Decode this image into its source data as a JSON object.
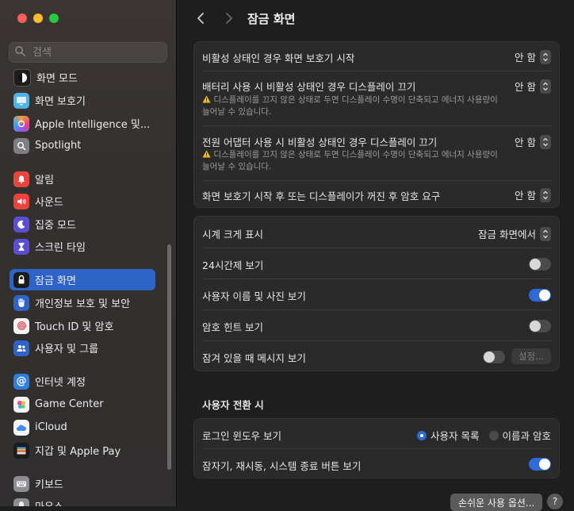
{
  "window": {
    "title": "잠금 화면"
  },
  "search": {
    "placeholder": "검색"
  },
  "sidebar": {
    "items": [
      {
        "label": "화면 모드",
        "icon": "appearance-icon"
      },
      {
        "label": "화면 보호기",
        "icon": "screen-saver-icon"
      },
      {
        "label": "Apple Intelligence 및...",
        "icon": "apple-intelligence-icon"
      },
      {
        "label": "Spotlight",
        "icon": "spotlight-icon"
      },
      {
        "label": "알림",
        "icon": "notifications-icon"
      },
      {
        "label": "사운드",
        "icon": "sound-icon"
      },
      {
        "label": "집중 모드",
        "icon": "focus-icon"
      },
      {
        "label": "스크린 타임",
        "icon": "screen-time-icon"
      },
      {
        "label": "잠금 화면",
        "icon": "lock-screen-icon",
        "selected": true
      },
      {
        "label": "개인정보 보호 및 보안",
        "icon": "privacy-hand-icon"
      },
      {
        "label": "Touch ID 및 암호",
        "icon": "fingerprint-icon"
      },
      {
        "label": "사용자 및 그룹",
        "icon": "users-icon"
      },
      {
        "label": "인터넷 계정",
        "icon": "internet-accounts-icon"
      },
      {
        "label": "Game Center",
        "icon": "game-center-icon"
      },
      {
        "label": "iCloud",
        "icon": "icloud-icon"
      },
      {
        "label": "지갑 및 Apple Pay",
        "icon": "wallet-icon"
      },
      {
        "label": "키보드",
        "icon": "keyboard-icon"
      },
      {
        "label": "마우스",
        "icon": "mouse-icon"
      }
    ]
  },
  "group1": {
    "rows": [
      {
        "label": "비활성 상태인 경우 화면 보호기 시작",
        "value": "안 함"
      },
      {
        "label": "배터리 사용 시 비활성 상태인 경우 디스플레이 끄기",
        "value": "안 함",
        "warning": "디스플레이를 끄지 않은 상태로 두면 디스플레이 수명이 단축되고 에너지 사용량이 늘어날 수 있습니다."
      },
      {
        "label": "전원 어댑터 사용 시 비활성 상태인 경우 디스플레이 끄기",
        "value": "안 함",
        "warning": "디스플레이를 끄지 않은 상태로 두면 디스플레이 수명이 단축되고 에너지 사용량이 늘어날 수 있습니다."
      },
      {
        "label": "화면 보호기 시작 후 또는 디스플레이가 꺼진 후 암호 요구",
        "value": "안 함"
      }
    ]
  },
  "group2": {
    "clock_size": {
      "label": "시계 크게 표시",
      "value": "잠금 화면에서"
    },
    "show_24h": {
      "label": "24시간제 보기",
      "on": false
    },
    "show_user_photo": {
      "label": "사용자 이름 및 사진 보기",
      "on": true
    },
    "show_hint": {
      "label": "암호 힌트 보기",
      "on": false
    },
    "show_message": {
      "label": "잠겨 있을 때 메시지 보기",
      "on": false,
      "button": "설정..."
    }
  },
  "user_switch": {
    "section_title": "사용자 전환 시",
    "login_window": {
      "label": "로그인 윈도우 보기",
      "options": [
        "사용자 목록",
        "이름과 암호"
      ],
      "selected": "사용자 목록"
    },
    "show_buttons": {
      "label": "잠자기, 재시동, 시스템 종료 버튼 보기",
      "on": true
    }
  },
  "footer": {
    "accessibility_button": "손쉬운 사용 옵션...",
    "help_button": "?"
  },
  "colors": {
    "accent": "#2e63c7",
    "toggle_on": "#2e6ad8",
    "warning": "#f5c400"
  }
}
